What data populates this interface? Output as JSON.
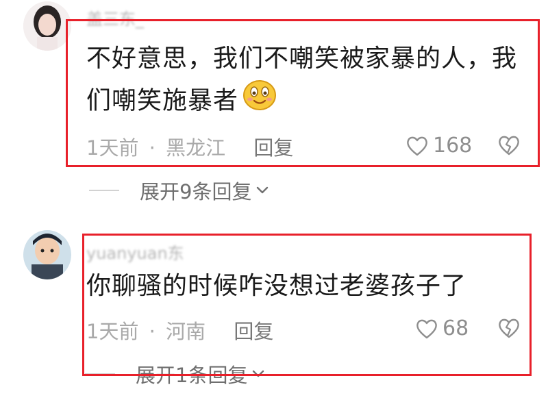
{
  "comments": [
    {
      "username": "盖三东_",
      "text_line1": "不好意思，我们不嘲笑被家暴的人，我",
      "text_line2": "们嘲笑施暴者",
      "emoji": "smiling-face",
      "time": "1天前",
      "separator": "·",
      "location": "黑龙江",
      "reply_label": "回复",
      "likes": "168",
      "expand_label": "展开9条回复"
    },
    {
      "username": "yuanyuan东",
      "text": "你聊骚的时候咋没想过老婆孩子了",
      "time": "1天前",
      "separator": "·",
      "location": "河南",
      "reply_label": "回复",
      "likes": "68",
      "expand_label": "展开1条回复"
    }
  ],
  "colors": {
    "highlight_box": "#e8202a",
    "meta_text": "#a9a9a9"
  },
  "icons": [
    "heart-icon",
    "broken-heart-icon",
    "chevron-down-icon"
  ]
}
